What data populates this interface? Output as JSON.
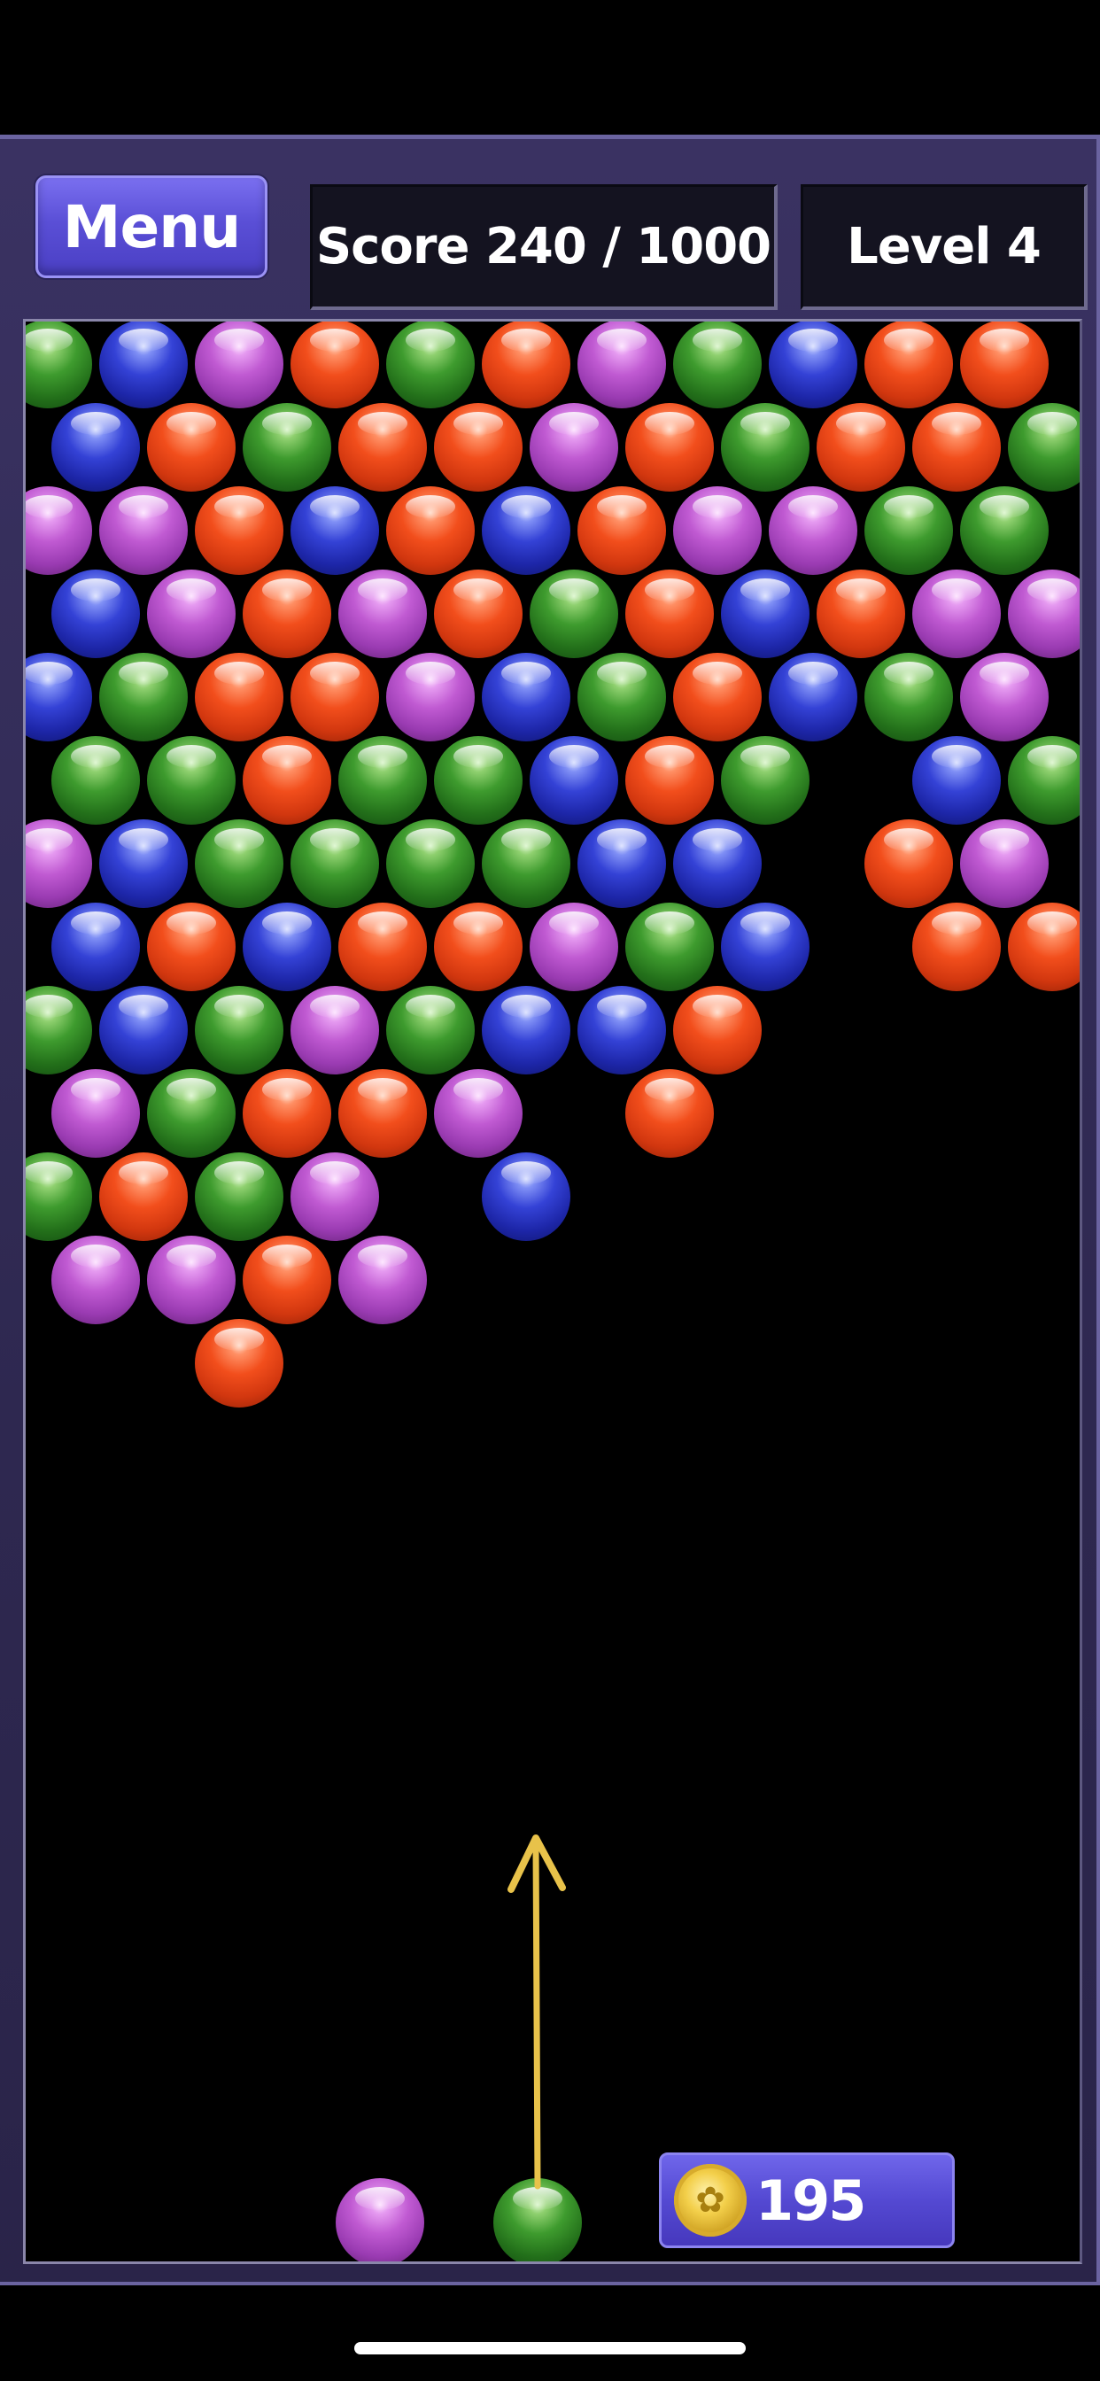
{
  "hud": {
    "menu_label": "Menu",
    "score_text": "Score 240 / 1000",
    "level_text": "Level 4"
  },
  "coins": {
    "count": "195",
    "icon": "coin-icon"
  },
  "colors": {
    "green": "#3e9b2e",
    "blue": "#3442d6",
    "orange": "#f24e1c",
    "purple": "#c05ad2",
    "aim_arrow": "#e8c24a",
    "frame": "#2e2850",
    "button": "#5a4fd6"
  },
  "board": {
    "rows": [
      [
        "green",
        "blue",
        "purple",
        "orange",
        "green",
        "orange",
        "purple",
        "green",
        "blue",
        "orange",
        "orange"
      ],
      [
        "blue",
        "orange",
        "green",
        "orange",
        "orange",
        "purple",
        "orange",
        "green",
        "orange",
        "orange",
        "green"
      ],
      [
        "purple",
        "purple",
        "orange",
        "blue",
        "orange",
        "blue",
        "orange",
        "purple",
        "purple",
        "green",
        "green"
      ],
      [
        "blue",
        "purple",
        "orange",
        "purple",
        "orange",
        "green",
        "orange",
        "blue",
        "orange",
        "purple",
        "purple"
      ],
      [
        "blue",
        "green",
        "orange",
        "orange",
        "purple",
        "blue",
        "green",
        "orange",
        "blue",
        "green",
        "purple"
      ],
      [
        "green",
        "green",
        "orange",
        "green",
        "green",
        "blue",
        "orange",
        "green",
        null,
        "blue",
        "green"
      ],
      [
        "purple",
        "blue",
        "green",
        "green",
        "green",
        "green",
        "blue",
        "blue",
        null,
        "orange",
        "purple"
      ],
      [
        "blue",
        "orange",
        "blue",
        "orange",
        "orange",
        "purple",
        "green",
        "blue",
        null,
        "orange",
        "orange"
      ],
      [
        "green",
        "blue",
        "green",
        "purple",
        "green",
        "blue",
        "blue",
        "orange",
        null,
        null,
        null
      ],
      [
        "purple",
        "green",
        "orange",
        "orange",
        "purple",
        null,
        "orange",
        null,
        null,
        null,
        null
      ],
      [
        "green",
        "orange",
        "green",
        "purple",
        null,
        "blue",
        null,
        null,
        null,
        null,
        null
      ],
      [
        "purple",
        "purple",
        "orange",
        "purple",
        null,
        null,
        null,
        null,
        null,
        null,
        null
      ],
      [
        null,
        null,
        "orange",
        null,
        null,
        null,
        null,
        null,
        null,
        null,
        null
      ]
    ],
    "next_bubble": "purple",
    "current_bubble": "green"
  }
}
